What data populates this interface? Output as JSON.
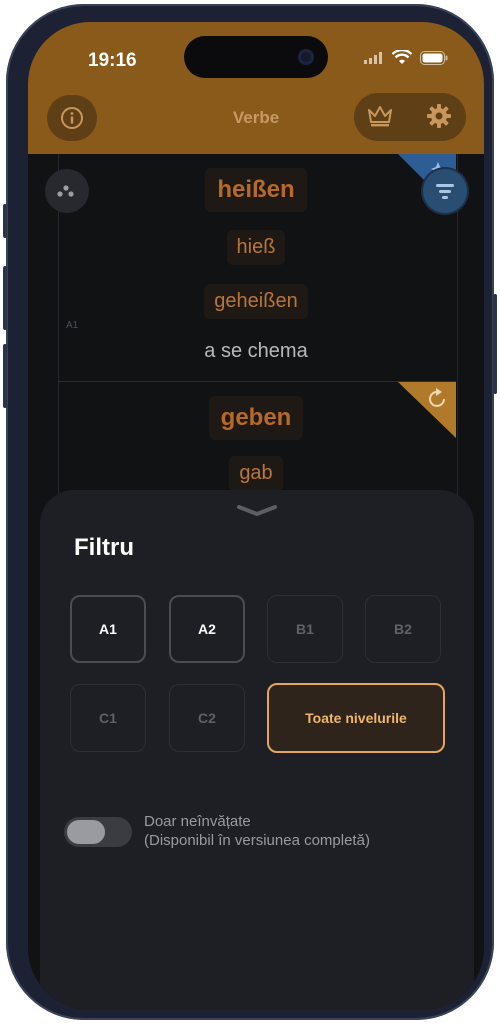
{
  "status": {
    "time": "19:16"
  },
  "header": {
    "title": "Verbe"
  },
  "cards": [
    {
      "infinitive": "heißen",
      "past": "hieß",
      "participle": "geheißen",
      "translation": "a se chema",
      "level": "A1"
    },
    {
      "infinitive": "geben",
      "past": "gab"
    }
  ],
  "filter": {
    "title": "Filtru",
    "levels": [
      {
        "label": "A1",
        "selected": true
      },
      {
        "label": "A2",
        "selected": true
      },
      {
        "label": "B1",
        "selected": false
      },
      {
        "label": "B2",
        "selected": false
      },
      {
        "label": "C1",
        "selected": false
      },
      {
        "label": "C2",
        "selected": false
      }
    ],
    "all_levels_label": "Toate nivelurile",
    "toggle_label": "Doar neînvățate",
    "toggle_note": "(Disponibil în versiunea completă)",
    "toggle_on": false
  },
  "colors": {
    "header": "#8a5a1b",
    "accent": "#e5a659",
    "sheet": "#1e1f24"
  },
  "icons": [
    "info-icon",
    "crown-icon",
    "gear-icon",
    "shuffle-icon",
    "filter-icon",
    "sparkle-icon",
    "refresh-icon",
    "chevron-down-icon",
    "wifi-icon",
    "battery-icon",
    "signal-icon"
  ]
}
